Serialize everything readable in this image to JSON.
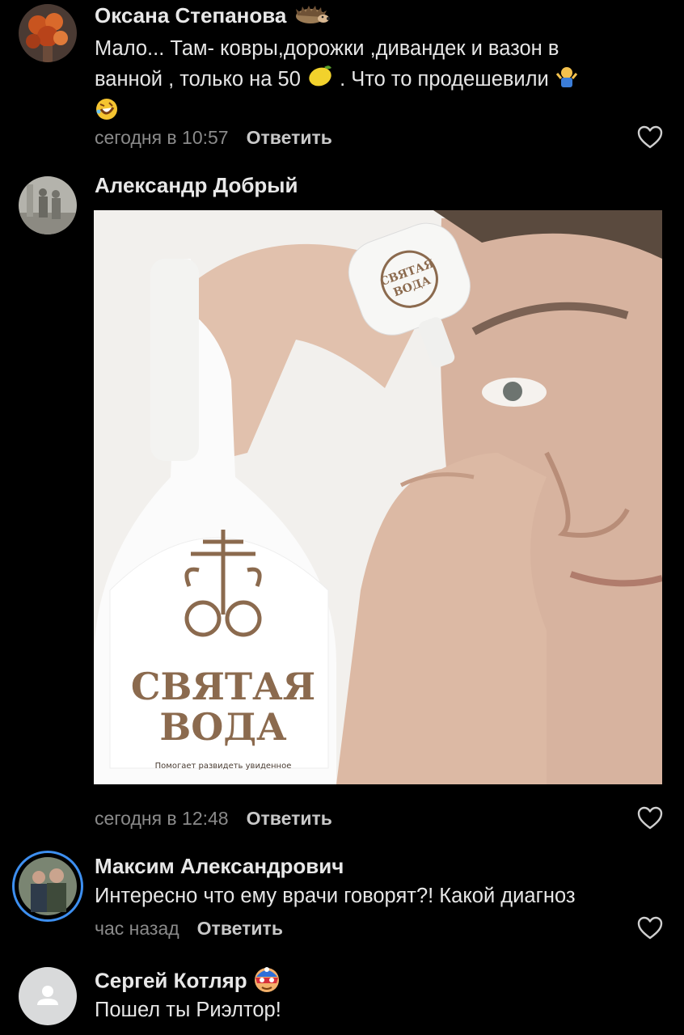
{
  "comments": [
    {
      "author": "Оксана Степанова",
      "text_line1": "Мало...  Там- ковры,дорожки ,дивандек и вазон в",
      "text_line2a": "ванной , только на 50",
      "text_line2b": ". Что то продешевили",
      "time": "сегодня в 10:57",
      "reply": "Ответить",
      "author_emoji": "hedgehog-emoji",
      "inline_emojis": [
        "lemon-emoji",
        "shrug-emoji",
        "rofl-emoji"
      ]
    },
    {
      "author": "Александр Добрый",
      "time": "сегодня в 12:48",
      "reply": "Ответить",
      "image": {
        "label_title_1": "СВЯТАЯ",
        "label_title_2": "ВОДА",
        "label_subtitle": "Помогает развидеть увиденное",
        "cap_line_1": "СВЯТАЯ",
        "cap_line_2": "ВОДА"
      }
    },
    {
      "author": "Максим Александрович",
      "text": "Интересно что ему врачи говорят?! Какой диагноз",
      "time": "час назад",
      "reply": "Ответить"
    },
    {
      "author": "Сергей Котляр",
      "text": "Пошел ты Риэлтор!",
      "author_emoji": "masked-hero-emoji"
    }
  ],
  "colors": {
    "background": "#000000",
    "meta": "#8a8a8a",
    "brown_label": "#8b6a4e"
  }
}
